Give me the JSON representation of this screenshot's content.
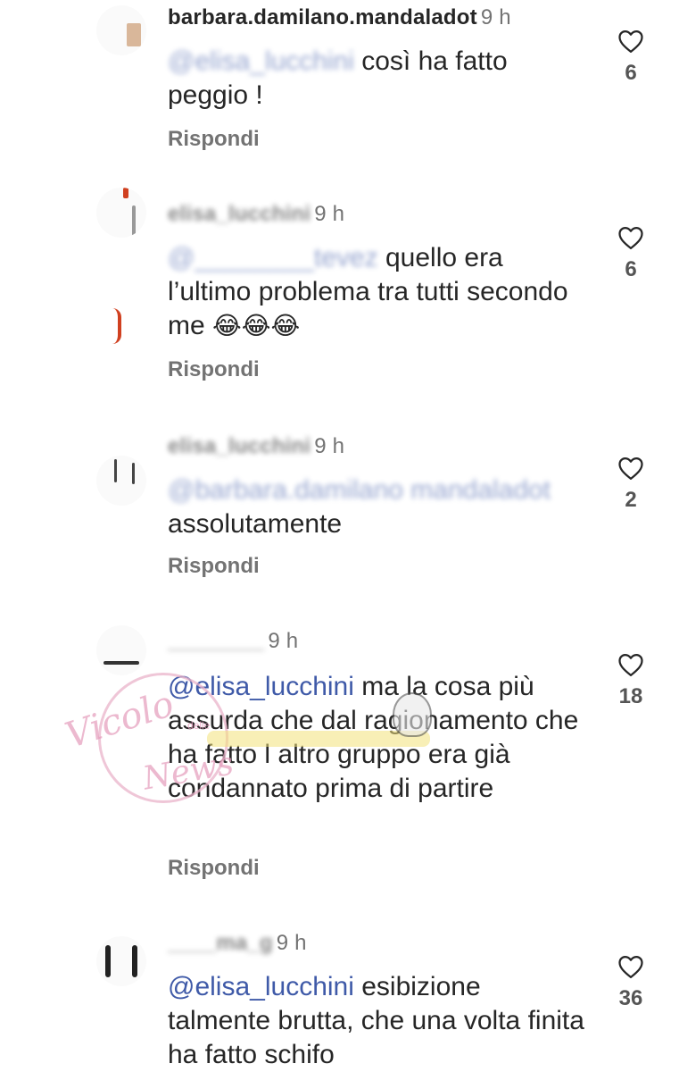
{
  "comments": [
    {
      "username": "barbara.damilano.mandaladot",
      "time": "9 h",
      "mention": "@elisa_lucchini",
      "text": " così ha fatto peggio !",
      "reply_label": "Rispondi",
      "likes": "6"
    },
    {
      "username": "elisa_lucchini",
      "time": "9 h",
      "mention": "@________tevez",
      "text": " quello era l’ultimo problema tra tutti secondo me ",
      "emoji": "😂😂😂",
      "reply_label": "Rispondi",
      "likes": "6"
    },
    {
      "username": "elisa_lucchini",
      "time": "9 h",
      "mention": "@barbara.damilano mandaladot",
      "text": " assolutamente",
      "reply_label": "Rispondi",
      "likes": "2"
    },
    {
      "username": "________",
      "time": "9 h",
      "mention": "@elisa_lucchini",
      "text": " ma la cosa più assurda che dal ragionamento che ha fatto l altro gruppo era già condannato prima di partire",
      "reply_label": "Rispondi",
      "likes": "18"
    },
    {
      "username": "____ma_g",
      "time": "9 h",
      "mention": "@elisa_lucchini",
      "text": " esibizione talmente brutta, che una volta finita ha fatto schifo",
      "likes": "36"
    }
  ],
  "watermark": {
    "line1": "Vicolo",
    "small": "delle",
    "line2": "News"
  },
  "icons": {
    "like": "heart-outline-icon"
  },
  "colors": {
    "mention": "#3f5aa8",
    "secondary": "#737373",
    "text": "#262626"
  }
}
